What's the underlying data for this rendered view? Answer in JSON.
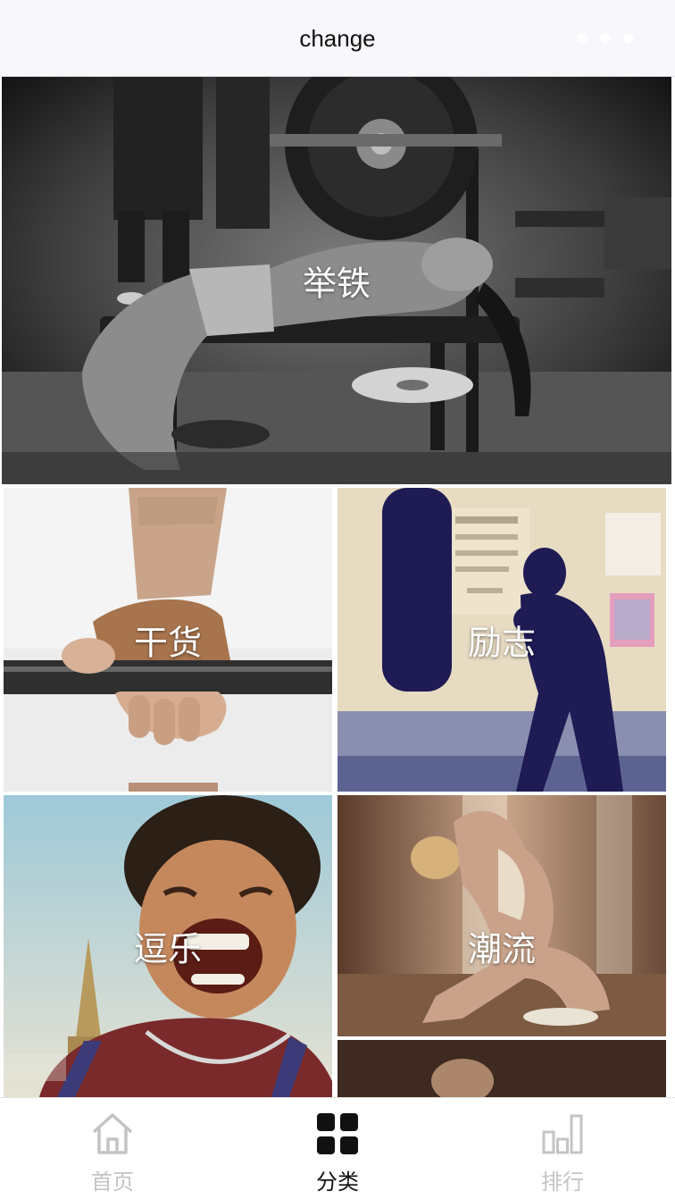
{
  "header": {
    "title": "change"
  },
  "categories": [
    {
      "id": "weightlifting",
      "label": "举铁"
    },
    {
      "id": "dry-goods",
      "label": "干货"
    },
    {
      "id": "motivation",
      "label": "励志"
    },
    {
      "id": "fun",
      "label": "逗乐"
    },
    {
      "id": "trend",
      "label": "潮流"
    }
  ],
  "tabbar": {
    "items": [
      {
        "label": "首页",
        "icon": "home-icon",
        "active": false
      },
      {
        "label": "分类",
        "icon": "category-grid-icon",
        "active": true
      },
      {
        "label": "排行",
        "icon": "ranking-bars-icon",
        "active": false
      }
    ]
  },
  "colors": {
    "header_bg": "#f8f7fb",
    "active_tab": "#111111",
    "inactive_tab": "#c4c4c4",
    "label_text": "#ffffff"
  }
}
